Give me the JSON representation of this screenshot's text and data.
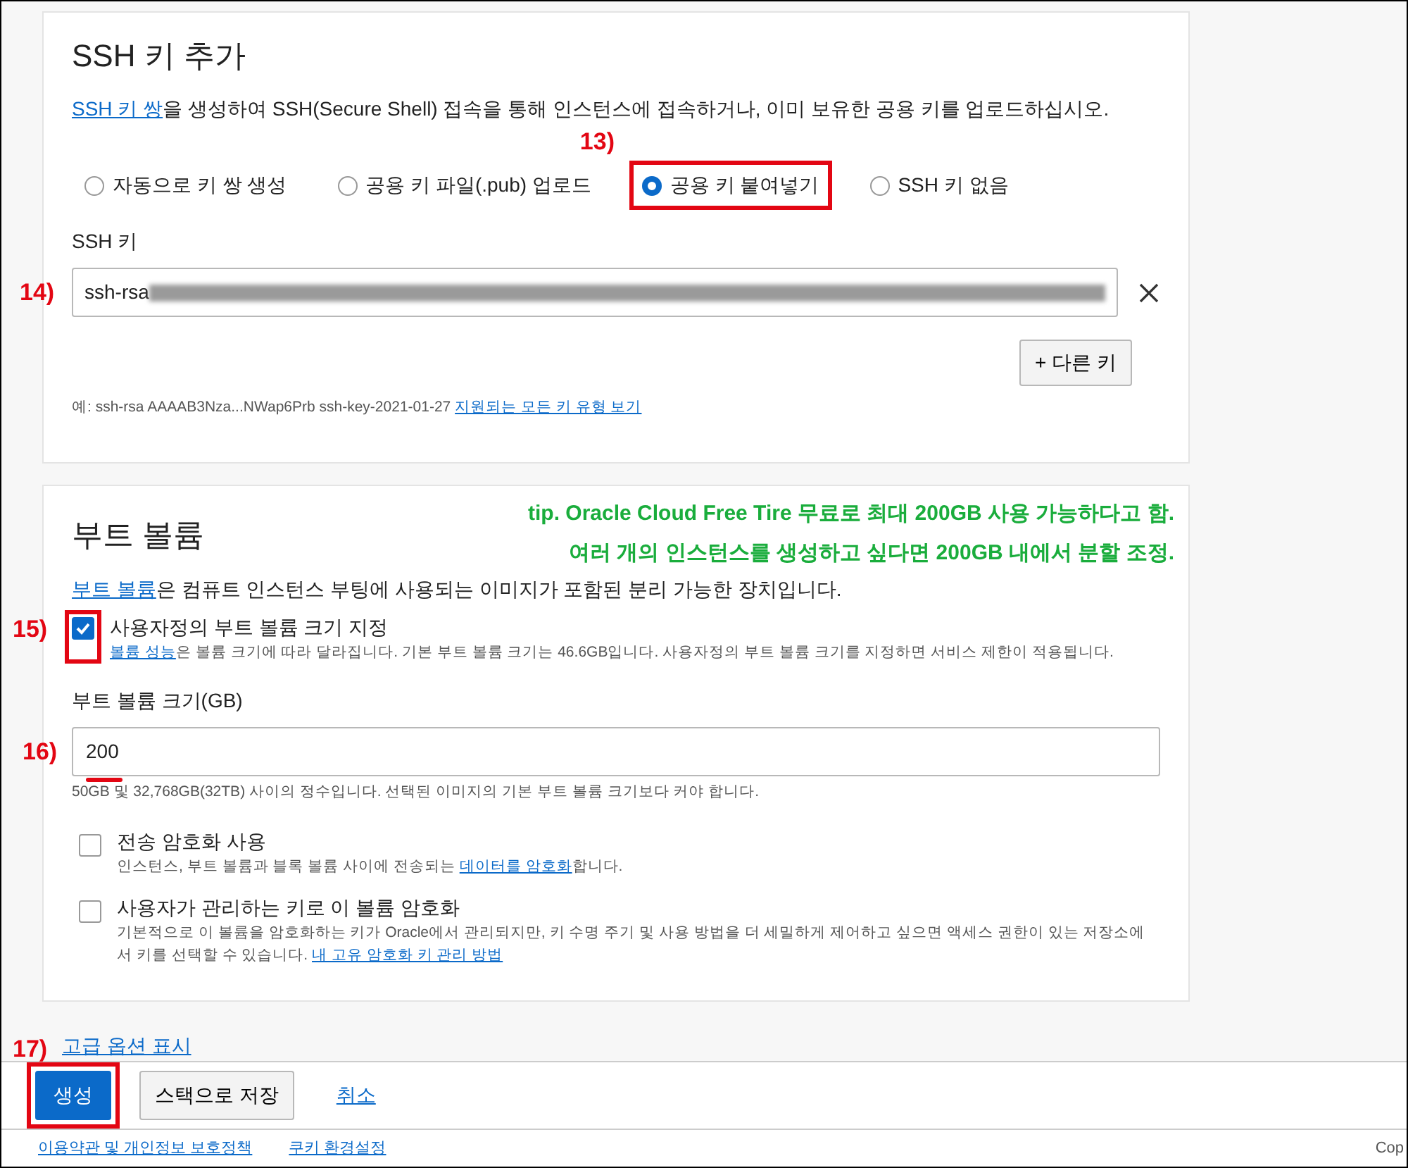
{
  "ssh_section": {
    "title": "SSH 키 추가",
    "description": {
      "link": "SSH 키 쌍",
      "after": "을 생성하여 SSH(Secure Shell) 접속을 통해 인스턴스에 접속하거나, 이미 보유한 공용 키를 업로드하십시오."
    },
    "options": [
      {
        "label": "자동으로 키 쌍 생성",
        "selected": false
      },
      {
        "label": "공용 키 파일(.pub) 업로드",
        "selected": false
      },
      {
        "label": "공용 키 붙여넣기",
        "selected": true,
        "marker": "13)",
        "highlighted": true
      },
      {
        "label": "SSH 키 없음",
        "selected": false
      }
    ],
    "key_field": {
      "label": "SSH 키",
      "value": "ssh-rsa",
      "marker": "14)"
    },
    "add_key_button": "+ 다른 키",
    "example": {
      "before": "예: ssh-rsa AAAAB3Nza...NWap6Prb ssh-key-2021-01-27 ",
      "link": "지원되는 모든 키 유형 보기"
    }
  },
  "boot_volume": {
    "title": "부트 볼륨",
    "tip": [
      "tip. Oracle Cloud Free Tire 무료로 최대 200GB 사용 가능하다고 함.",
      "여러 개의 인스턴스를 생성하고 싶다면 200GB 내에서 분할 조정."
    ],
    "description": {
      "link": "부트 볼륨",
      "after": "은 컴퓨트 인스턴스 부팅에 사용되는 이미지가 포함된 분리 가능한 장치입니다."
    },
    "options": [
      {
        "label": "사용자정의 부트 볼륨 크기 지정",
        "checked": true,
        "marker": "15)",
        "highlighted": true,
        "help": {
          "link": "볼륨 성능",
          "after": "은 볼륨 크기에 따라 달라집니다. 기본 부트 볼륨 크기는 46.6GB입니다. 사용자정의 부트 볼륨 크기를 지정하면 서비스 제한이 적용됩니다."
        },
        "size_field": {
          "label": "부트 볼륨 크기(GB)",
          "value": "200",
          "marker": "16)",
          "underlined": true,
          "help": "50GB 및 32,768GB(32TB) 사이의 정수입니다. 선택된 이미지의 기본 부트 볼륨 크기보다 커야 합니다."
        }
      },
      {
        "label": "전송 암호화 사용",
        "checked": false,
        "help": {
          "before": "인스턴스, 부트 볼륨과 블록 볼륨 사이에 전송되는 ",
          "link": "데이터를 암호화",
          "after": "합니다."
        }
      },
      {
        "label": "사용자가 관리하는 키로 이 볼륨 암호화",
        "checked": false,
        "help": {
          "before": "기본적으로 이 볼륨을 암호화하는 키가 Oracle에서 관리되지만, 키 수명 주기 및 사용 방법을 더 세밀하게 제어하고 싶으면 액세스 권한이 있는 저장소에서 키를 선택할 수 있습니다. ",
          "link": "내 고유 암호화 키 관리 방법"
        }
      }
    ]
  },
  "advanced_link": "고급 옵션 표시",
  "action_bar": {
    "marker": "17)",
    "buttons": [
      {
        "label": "생성",
        "kind": "primary",
        "highlighted": true
      },
      {
        "label": "스택으로 저장",
        "kind": "secondary"
      },
      {
        "label": "취소",
        "kind": "link"
      }
    ]
  },
  "footer": {
    "links": [
      "이용약관 및 개인정보 보호정책",
      "쿠키 환경설정"
    ],
    "copyright": "Cop"
  }
}
